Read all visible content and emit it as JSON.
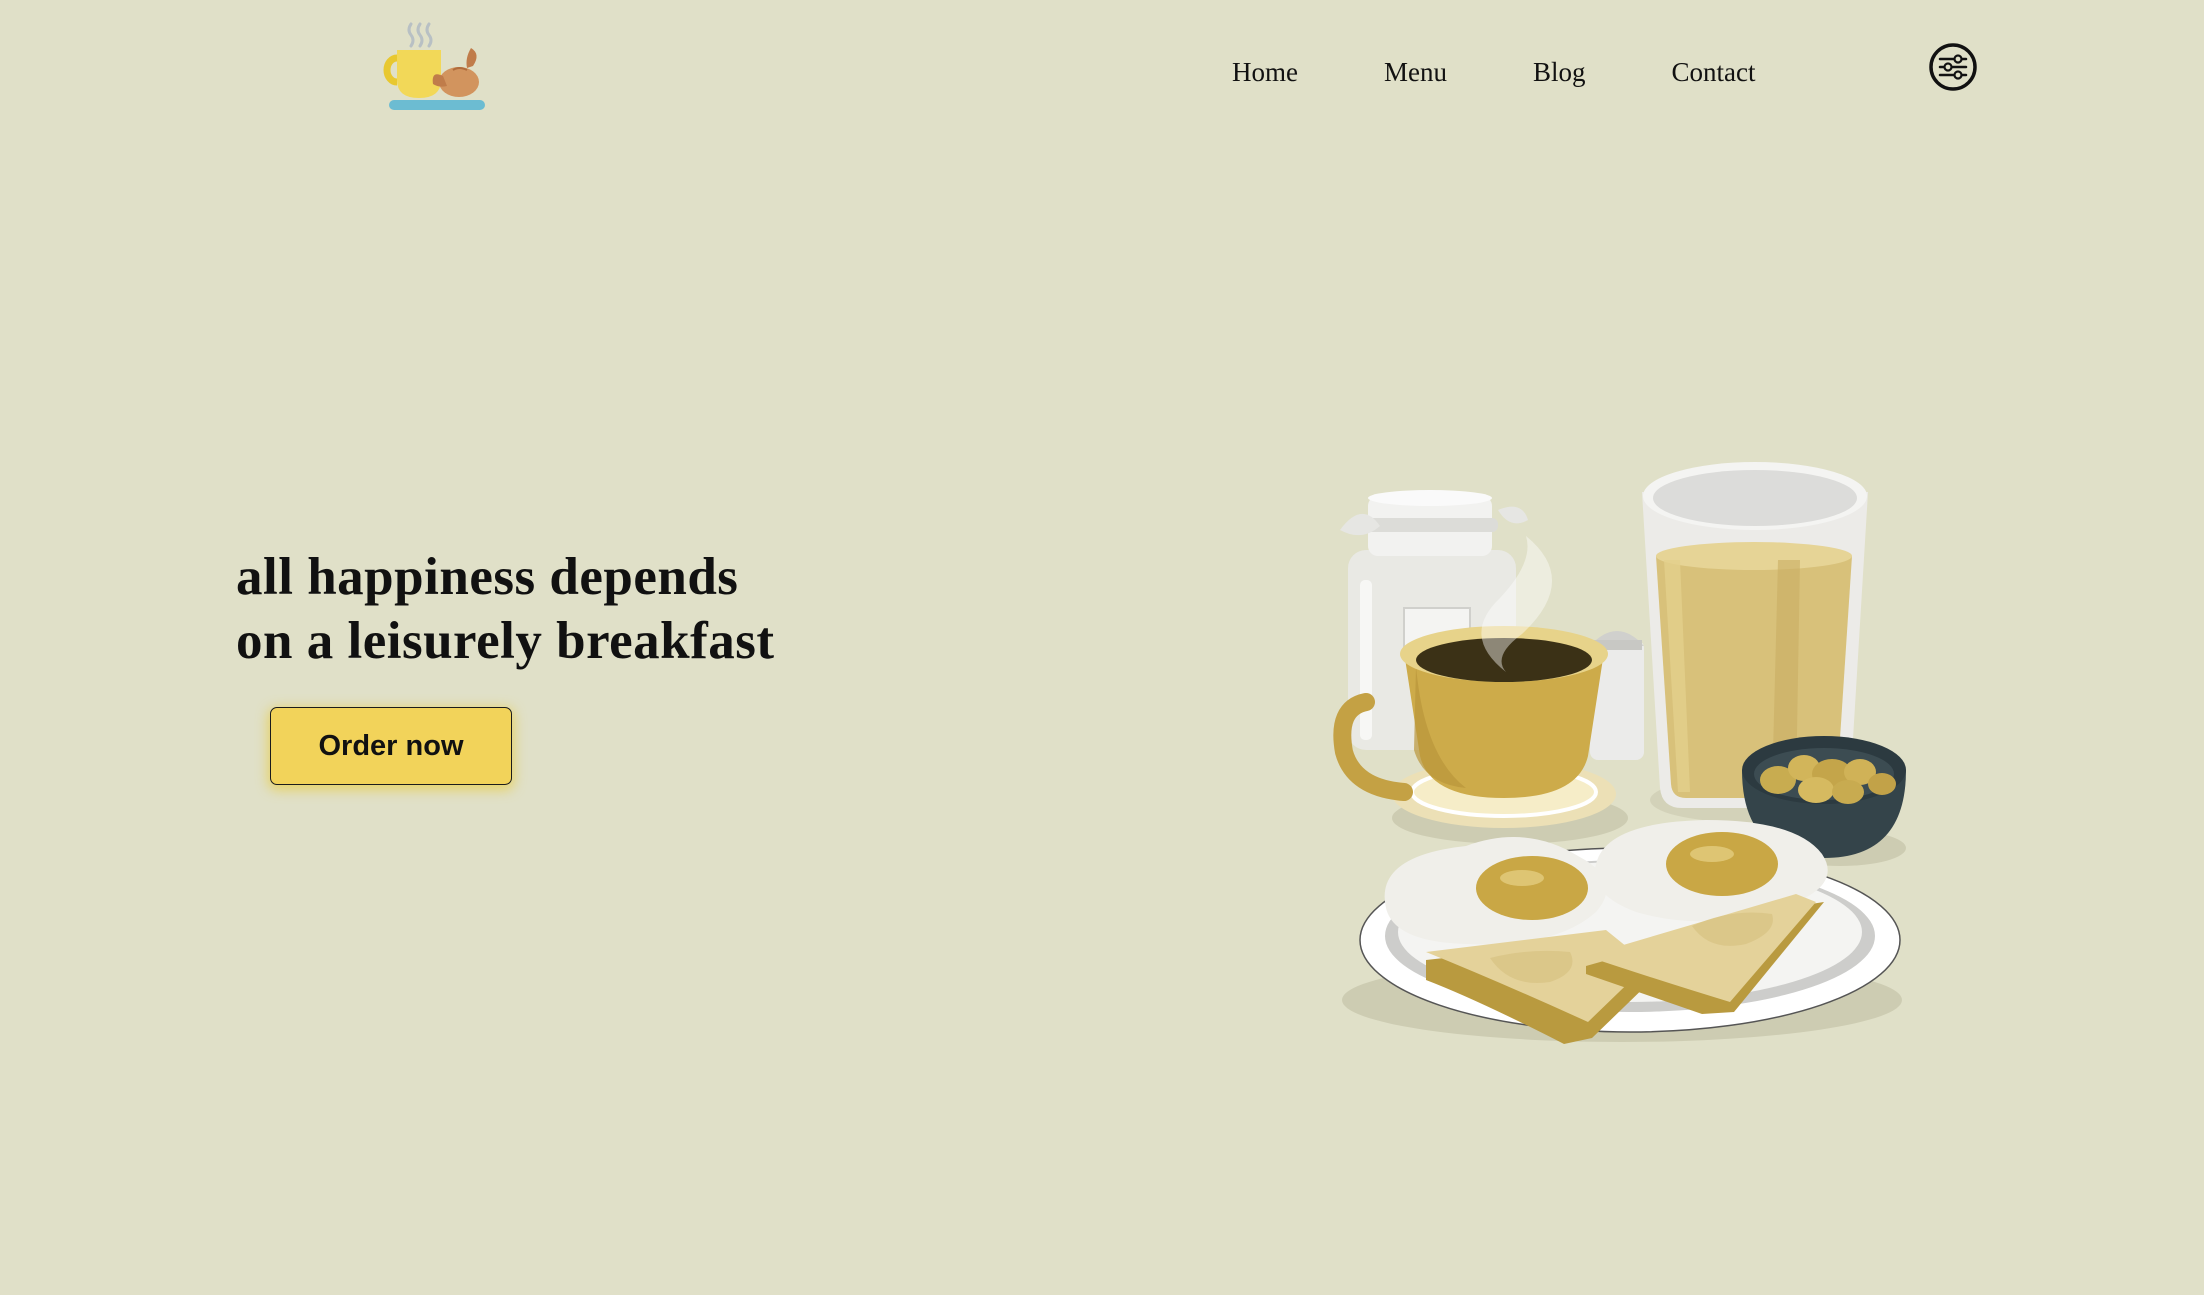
{
  "header": {
    "logo_icon": "coffee-croissant-logo-icon",
    "nav": [
      {
        "label": "Home"
      },
      {
        "label": "Menu"
      },
      {
        "label": "Blog"
      },
      {
        "label": "Contact"
      }
    ],
    "settings_icon": "sliders-settings-icon"
  },
  "hero": {
    "title_line1": "all happiness depends",
    "title_line2": "on a leisurely breakfast",
    "cta_label": "Order now",
    "illustration_icon": "breakfast-illustration"
  },
  "colors": {
    "background": "#e0e0c8",
    "button": "#f2d35a",
    "accent_mustard": "#c8a845"
  }
}
